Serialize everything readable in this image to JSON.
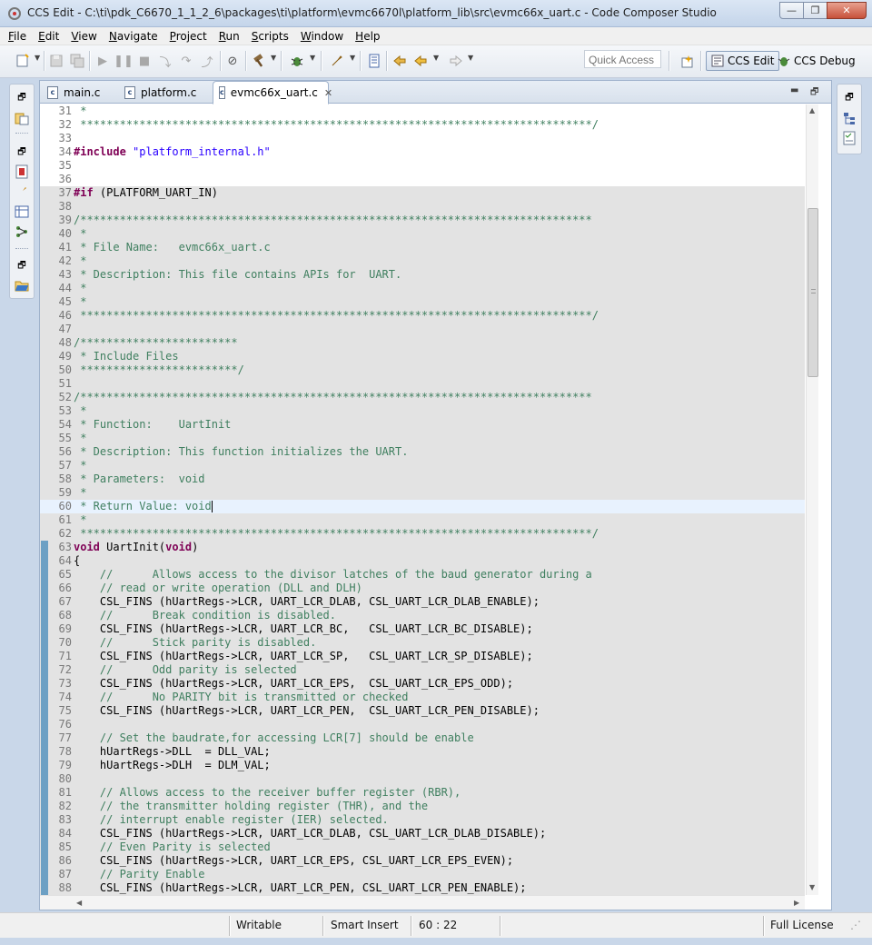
{
  "window": {
    "title": "CCS Edit - C:\\ti\\pdk_C6670_1_1_2_6\\packages\\ti\\platform\\evmc6670l\\platform_lib\\src\\evmc66x_uart.c - Code Composer Studio",
    "minimize_glyph": "—",
    "maximize_glyph": "❐",
    "close_glyph": "✕"
  },
  "menu": [
    "File",
    "Edit",
    "View",
    "Navigate",
    "Project",
    "Run",
    "Scripts",
    "Window",
    "Help"
  ],
  "toolbar": {
    "quick_access_placeholder": "Quick Access",
    "perspectives": [
      {
        "label": "CCS Edit",
        "active": true
      },
      {
        "label": "CCS Debug",
        "active": false
      }
    ]
  },
  "tabs": [
    {
      "label": "main.c",
      "icon": "c-file-icon",
      "active": false
    },
    {
      "label": "platform.c",
      "icon": "c-file-icon",
      "active": false
    },
    {
      "label": "evmc66x_uart.c",
      "icon": "c-file-icon",
      "active": true,
      "close": "✕"
    }
  ],
  "code": [
    {
      "n": "31",
      "t": " *",
      "k": "comment"
    },
    {
      "n": "32",
      "t": " ******************************************************************************/",
      "k": "comment"
    },
    {
      "n": "33",
      "t": "",
      "k": "plain"
    },
    {
      "n": "34",
      "t": "",
      "k": "include",
      "pre": "#include",
      "str": " \"platform_internal.h\""
    },
    {
      "n": "35",
      "t": "",
      "k": "plain"
    },
    {
      "n": "36",
      "t": "",
      "k": "plain"
    },
    {
      "n": "37",
      "t": " (PLATFORM_UART_IN)",
      "k": "if",
      "pre": "#if",
      "bg": "inactive"
    },
    {
      "n": "38",
      "t": "",
      "k": "plain",
      "bg": "inactive"
    },
    {
      "n": "39",
      "t": "/******************************************************************************",
      "k": "comment",
      "bg": "inactive"
    },
    {
      "n": "40",
      "t": " *",
      "k": "comment",
      "bg": "inactive"
    },
    {
      "n": "41",
      "t": " * File Name:   evmc66x_uart.c",
      "k": "comment",
      "bg": "inactive"
    },
    {
      "n": "42",
      "t": " *",
      "k": "comment",
      "bg": "inactive"
    },
    {
      "n": "43",
      "t": " * Description: This file contains APIs for  UART.",
      "k": "comment",
      "bg": "inactive"
    },
    {
      "n": "44",
      "t": " *",
      "k": "comment",
      "bg": "inactive"
    },
    {
      "n": "45",
      "t": " *",
      "k": "comment",
      "bg": "inactive"
    },
    {
      "n": "46",
      "t": " ******************************************************************************/",
      "k": "comment",
      "bg": "inactive"
    },
    {
      "n": "47",
      "t": "",
      "k": "plain",
      "bg": "inactive"
    },
    {
      "n": "48",
      "t": "/************************",
      "k": "comment",
      "bg": "inactive"
    },
    {
      "n": "49",
      "t": " * Include Files",
      "k": "comment",
      "bg": "inactive"
    },
    {
      "n": "50",
      "t": " ************************/",
      "k": "comment",
      "bg": "inactive"
    },
    {
      "n": "51",
      "t": "",
      "k": "plain",
      "bg": "inactive"
    },
    {
      "n": "52",
      "t": "/******************************************************************************",
      "k": "comment",
      "bg": "inactive"
    },
    {
      "n": "53",
      "t": " *",
      "k": "comment",
      "bg": "inactive"
    },
    {
      "n": "54",
      "t": " * Function:    UartInit",
      "k": "comment",
      "bg": "inactive"
    },
    {
      "n": "55",
      "t": " *",
      "k": "comment",
      "bg": "inactive"
    },
    {
      "n": "56",
      "t": " * Description: This function initializes the UART.",
      "k": "comment",
      "bg": "inactive"
    },
    {
      "n": "57",
      "t": " *",
      "k": "comment",
      "bg": "inactive"
    },
    {
      "n": "58",
      "t": " * Parameters:  void",
      "k": "comment",
      "bg": "inactive"
    },
    {
      "n": "59",
      "t": " *",
      "k": "comment",
      "bg": "inactive"
    },
    {
      "n": "60",
      "t": " * Return Value: void",
      "k": "comment",
      "bg": "current",
      "caret": true
    },
    {
      "n": "61",
      "t": " *",
      "k": "comment",
      "bg": "inactive"
    },
    {
      "n": "62",
      "t": " ******************************************************************************/",
      "k": "comment",
      "bg": "inactive"
    },
    {
      "n": "63",
      "t": " UartInit(",
      "k": "func",
      "kw1": "void",
      "kw2": "void",
      "tail": ")",
      "bg": "inactive",
      "marker": true
    },
    {
      "n": "64",
      "t": "{",
      "k": "plain",
      "bg": "inactive",
      "marker": true
    },
    {
      "n": "65",
      "t": "    //      Allows access to the divisor latches of the baud generator during a",
      "k": "comment",
      "bg": "inactive",
      "marker": true
    },
    {
      "n": "66",
      "t": "    // read or write operation (DLL and DLH)",
      "k": "comment",
      "bg": "inactive",
      "marker": true
    },
    {
      "n": "67",
      "t": "    CSL_FINS (hUartRegs->LCR, UART_LCR_DLAB, CSL_UART_LCR_DLAB_ENABLE);",
      "k": "plain",
      "bg": "inactive",
      "marker": true
    },
    {
      "n": "68",
      "t": "    //      Break condition is disabled.",
      "k": "comment",
      "bg": "inactive",
      "marker": true
    },
    {
      "n": "69",
      "t": "    CSL_FINS (hUartRegs->LCR, UART_LCR_BC,   CSL_UART_LCR_BC_DISABLE);",
      "k": "plain",
      "bg": "inactive",
      "marker": true
    },
    {
      "n": "70",
      "t": "    //      Stick parity is disabled.",
      "k": "comment",
      "bg": "inactive",
      "marker": true
    },
    {
      "n": "71",
      "t": "    CSL_FINS (hUartRegs->LCR, UART_LCR_SP,   CSL_UART_LCR_SP_DISABLE);",
      "k": "plain",
      "bg": "inactive",
      "marker": true
    },
    {
      "n": "72",
      "t": "    //      Odd parity is selected",
      "k": "comment",
      "bg": "inactive",
      "marker": true
    },
    {
      "n": "73",
      "t": "    CSL_FINS (hUartRegs->LCR, UART_LCR_EPS,  CSL_UART_LCR_EPS_ODD);",
      "k": "plain",
      "bg": "inactive",
      "marker": true
    },
    {
      "n": "74",
      "t": "    //      No PARITY bit is transmitted or checked",
      "k": "comment",
      "bg": "inactive",
      "marker": true
    },
    {
      "n": "75",
      "t": "    CSL_FINS (hUartRegs->LCR, UART_LCR_PEN,  CSL_UART_LCR_PEN_DISABLE);",
      "k": "plain",
      "bg": "inactive",
      "marker": true
    },
    {
      "n": "76",
      "t": "",
      "k": "plain",
      "bg": "inactive",
      "marker": true
    },
    {
      "n": "77",
      "t": "    // Set the baudrate,for accessing LCR[7] should be enable",
      "k": "comment",
      "bg": "inactive",
      "marker": true
    },
    {
      "n": "78",
      "t": "    hUartRegs->DLL  = DLL_VAL;",
      "k": "plain",
      "bg": "inactive",
      "marker": true
    },
    {
      "n": "79",
      "t": "    hUartRegs->DLH  = DLM_VAL;",
      "k": "plain",
      "bg": "inactive",
      "marker": true
    },
    {
      "n": "80",
      "t": "",
      "k": "plain",
      "bg": "inactive",
      "marker": true
    },
    {
      "n": "81",
      "t": "    // Allows access to the receiver buffer register (RBR),",
      "k": "comment",
      "bg": "inactive",
      "marker": true
    },
    {
      "n": "82",
      "t": "    // the transmitter holding register (THR), and the",
      "k": "comment",
      "bg": "inactive",
      "marker": true
    },
    {
      "n": "83",
      "t": "    // interrupt enable register (IER) selected.",
      "k": "comment",
      "bg": "inactive",
      "marker": true
    },
    {
      "n": "84",
      "t": "    CSL_FINS (hUartRegs->LCR, UART_LCR_DLAB, CSL_UART_LCR_DLAB_DISABLE);",
      "k": "plain",
      "bg": "inactive",
      "marker": true
    },
    {
      "n": "85",
      "t": "    // Even Parity is selected",
      "k": "comment",
      "bg": "inactive",
      "marker": true
    },
    {
      "n": "86",
      "t": "    CSL_FINS (hUartRegs->LCR, UART_LCR_EPS, CSL_UART_LCR_EPS_EVEN);",
      "k": "plain",
      "bg": "inactive",
      "marker": true
    },
    {
      "n": "87",
      "t": "    // Parity Enable",
      "k": "comment",
      "bg": "inactive",
      "marker": true
    },
    {
      "n": "88",
      "t": "    CSL_FINS (hUartRegs->LCR, UART_LCR_PEN, CSL_UART_LCR_PEN_ENABLE);",
      "k": "plain",
      "bg": "inactive",
      "marker": true
    }
  ],
  "status": {
    "writable": "Writable",
    "insert_mode": "Smart Insert",
    "position": "60 : 22",
    "license": "Full License"
  },
  "colors": {
    "comment": "#3f7f5f",
    "keyword": "#7f0055",
    "string": "#2a00ff",
    "inactive_bg": "#e3e3e3",
    "current_line_bg": "#e8f2fe"
  }
}
